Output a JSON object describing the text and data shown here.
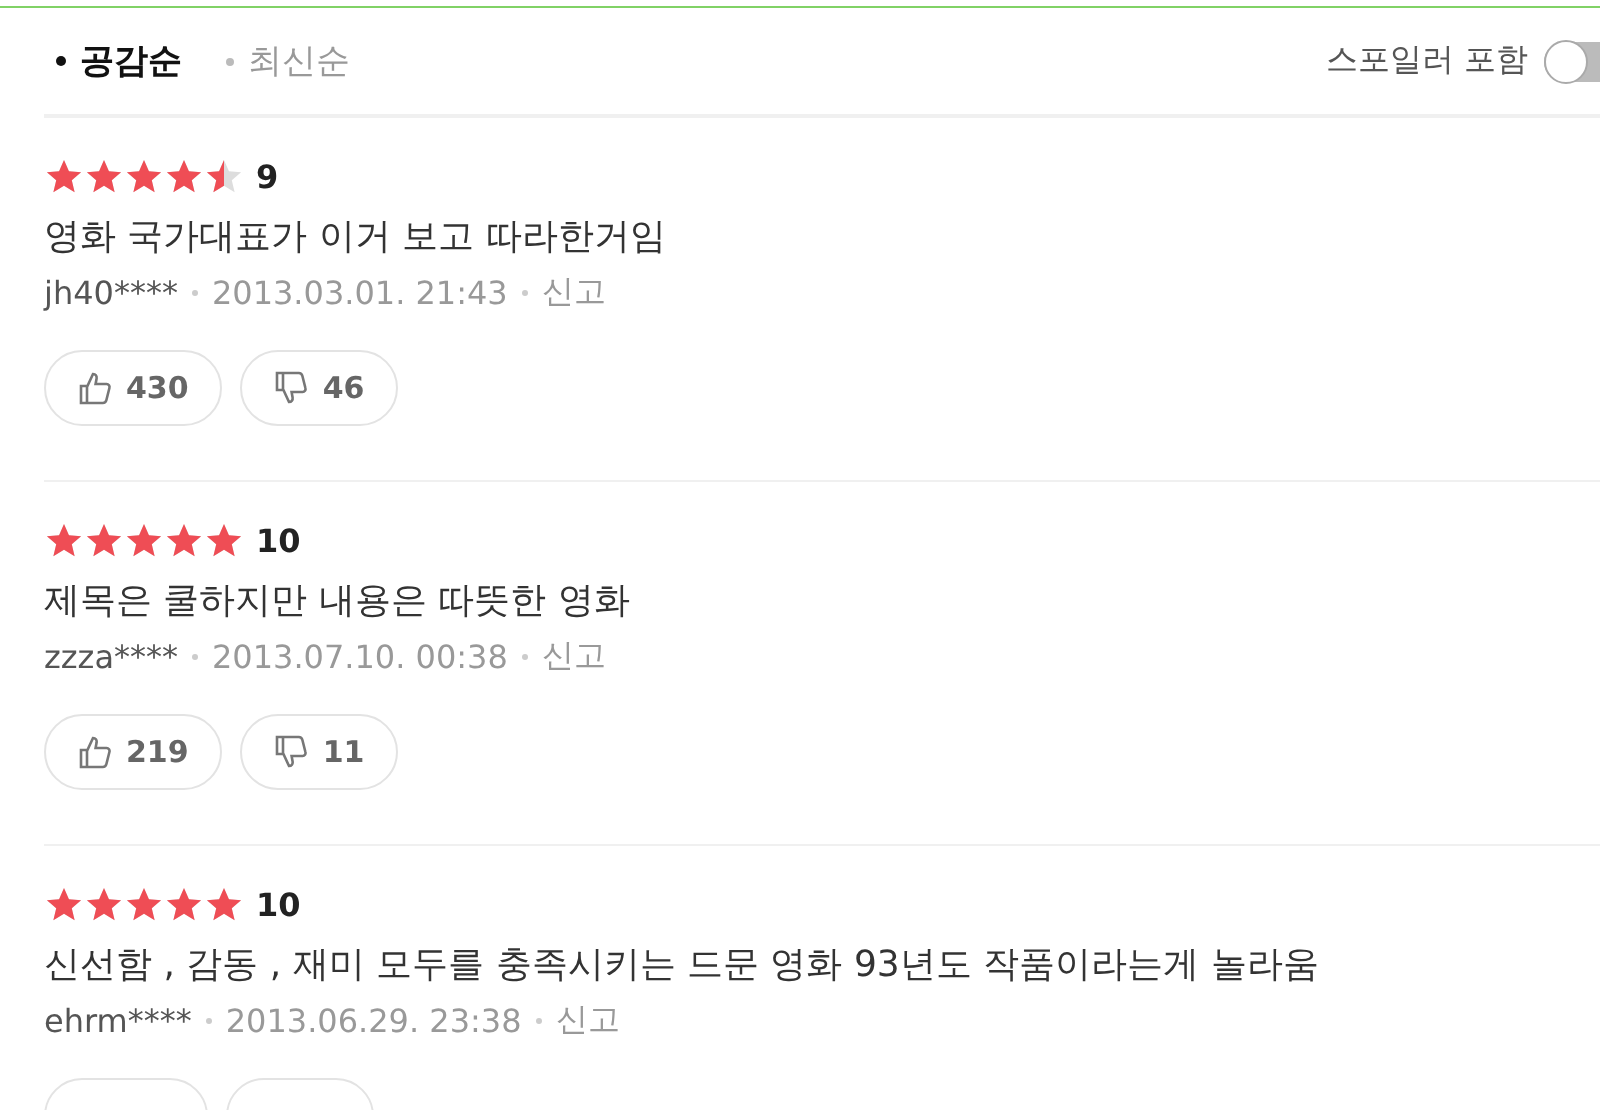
{
  "sort_tabs": [
    {
      "label": "공감순",
      "selected": true
    },
    {
      "label": "최신순",
      "selected": false
    }
  ],
  "spoiler_toggle": {
    "label": "스포일러 포함",
    "on": false
  },
  "reviews": [
    {
      "stars": 4.5,
      "score": "9",
      "text": "영화 국가대표가 이거 보고 따라한거임",
      "user": "jh40****",
      "date": "2013.03.01. 21:43",
      "report": "신고",
      "likes": "430",
      "dislikes": "46"
    },
    {
      "stars": 5,
      "score": "10",
      "text": "제목은 쿨하지만 내용은 따뜻한 영화",
      "user": "zzza****",
      "date": "2013.07.10. 00:38",
      "report": "신고",
      "likes": "219",
      "dislikes": "11"
    },
    {
      "stars": 5,
      "score": "10",
      "text": "신선함 , 감동 , 재미 모두를 충족시키는 드문 영화 93년도 작품이라는게 놀라움",
      "user": "ehrm****",
      "date": "2013.06.29. 23:38",
      "report": "신고"
    }
  ]
}
